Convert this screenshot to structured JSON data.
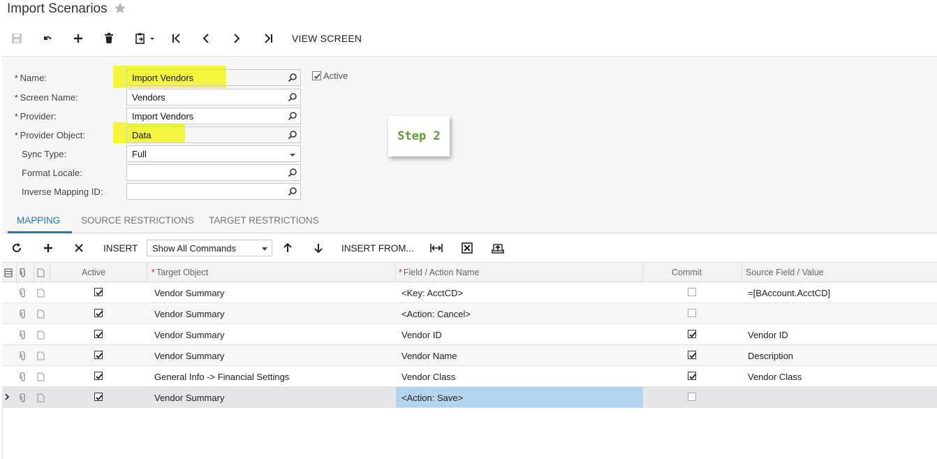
{
  "window": {
    "title": "Import Scenarios"
  },
  "toolbar": {
    "view_screen_label": "VIEW SCREEN"
  },
  "form": {
    "name_label": "Name:",
    "name_value": "Import Vendors",
    "screen_name_label": "Screen Name:",
    "screen_name_value": "Vendors",
    "provider_label": "Provider:",
    "provider_value": "Import Vendors",
    "provider_object_label": "Provider Object:",
    "provider_object_value": "Data",
    "sync_type_label": "Sync Type:",
    "sync_type_value": "Full",
    "format_locale_label": "Format Locale:",
    "format_locale_value": "",
    "inverse_mapping_label": "Inverse Mapping ID:",
    "inverse_mapping_value": "",
    "active_label": "Active",
    "active_checked": true,
    "required_marker": "*"
  },
  "annotation": {
    "step_text": "Step 2",
    "highlight_color": "#f4f62a"
  },
  "tabs": [
    {
      "label": "MAPPING",
      "active": true
    },
    {
      "label": "SOURCE RESTRICTIONS",
      "active": false
    },
    {
      "label": "TARGET RESTRICTIONS",
      "active": false
    }
  ],
  "grid_toolbar": {
    "insert_label": "INSERT",
    "command_filter_value": "Show All Commands",
    "insert_from_label": "INSERT FROM..."
  },
  "grid": {
    "headers": {
      "active": "Active",
      "target_object": "Target Object",
      "field_action": "Field / Action Name",
      "commit": "Commit",
      "source_field": "Source Field / Value"
    },
    "rows": [
      {
        "active": true,
        "target": "Vendor Summary",
        "field": "<Key: AcctCD>",
        "commit": false,
        "source": "=[BAccount.AcctCD]"
      },
      {
        "active": true,
        "target": "Vendor Summary",
        "field": "<Action: Cancel>",
        "commit": false,
        "source": ""
      },
      {
        "active": true,
        "target": "Vendor Summary",
        "field": "Vendor ID",
        "commit": true,
        "source": "Vendor ID"
      },
      {
        "active": true,
        "target": "Vendor Summary",
        "field": "Vendor Name",
        "commit": true,
        "source": "Description"
      },
      {
        "active": true,
        "target": "General Info -> Financial Settings",
        "field": "Vendor Class",
        "commit": true,
        "source": "Vendor Class"
      },
      {
        "active": true,
        "target": "Vendor Summary",
        "field": "<Action: Save>",
        "commit": false,
        "source": "",
        "selected": true
      }
    ]
  },
  "colors": {
    "accent": "#1b76bc",
    "selected_cell": "#b3d5ef",
    "step_text": "#5aa02c"
  }
}
